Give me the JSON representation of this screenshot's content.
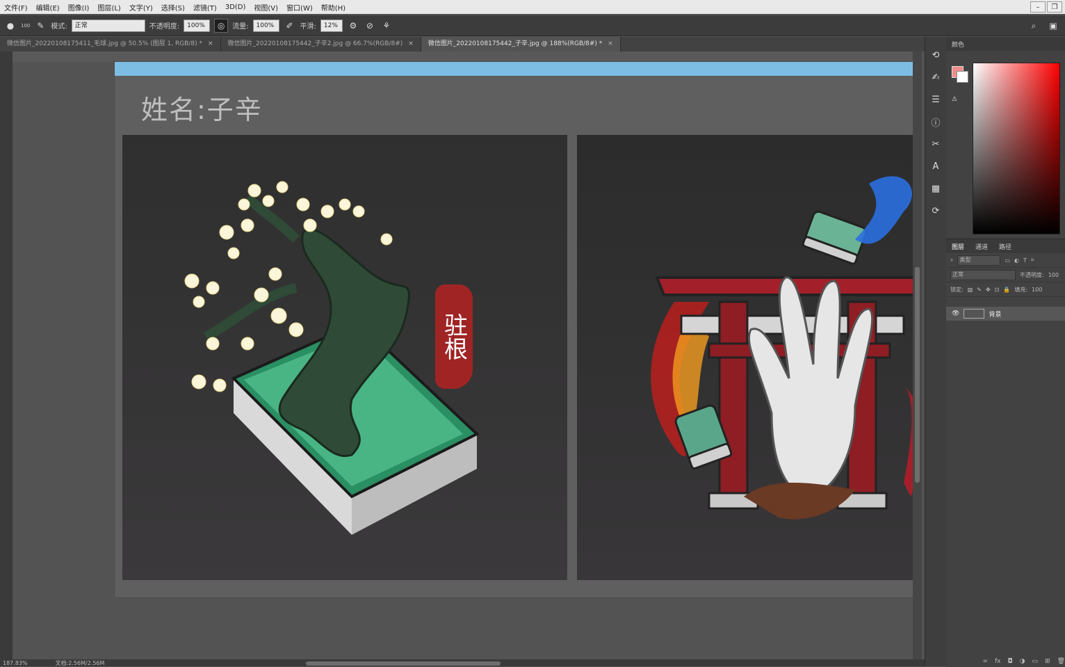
{
  "menu": [
    "文件(F)",
    "编辑(E)",
    "图像(I)",
    "图层(L)",
    "文字(Y)",
    "选择(S)",
    "滤镜(T)",
    "3D(D)",
    "视图(V)",
    "窗口(W)",
    "帮助(H)"
  ],
  "options": {
    "brush_size": "100",
    "mode_label": "模式:",
    "mode_value": "正常",
    "opacity_label": "不透明度:",
    "opacity_value": "100%",
    "flow_label": "流量:",
    "flow_value": "100%",
    "smooth_label": "平滑:",
    "smooth_value": "12%"
  },
  "tabs": [
    {
      "label": "微信图片_20220108175411_毛球.jpg @ 50.5% (图层 1, RGB/8) *",
      "active": false
    },
    {
      "label": "微信图片_20220108175442_子辛2.jpg @ 66.7%(RGB/8#)",
      "active": false
    },
    {
      "label": "微信图片_20220108175442_子辛.jpg @ 188%(RGB/8#) *",
      "active": true
    }
  ],
  "document": {
    "title_text": "姓名:子辛",
    "seal_text": "驻根"
  },
  "status": {
    "zoom": "187.83%",
    "doc_size": "文档:2.56M/2.56M"
  },
  "panel": {
    "color_tab": "颜色",
    "fg_color": "#f08c8c",
    "bg_color": "#ffffff",
    "layers_tabs": [
      "图层",
      "通道",
      "路径"
    ],
    "filter_placeholder": "类型",
    "blend_mode": "正常",
    "opacity_label": "不透明度:",
    "opacity_value": "100",
    "lock_label": "锁定:",
    "fill_label": "填充:",
    "fill_value": "100",
    "layer_name": "背景",
    "footer_icons": [
      "link-icon",
      "fx-icon",
      "mask-icon",
      "adjustment-icon",
      "group-icon",
      "new-layer-icon",
      "trash-icon"
    ]
  }
}
